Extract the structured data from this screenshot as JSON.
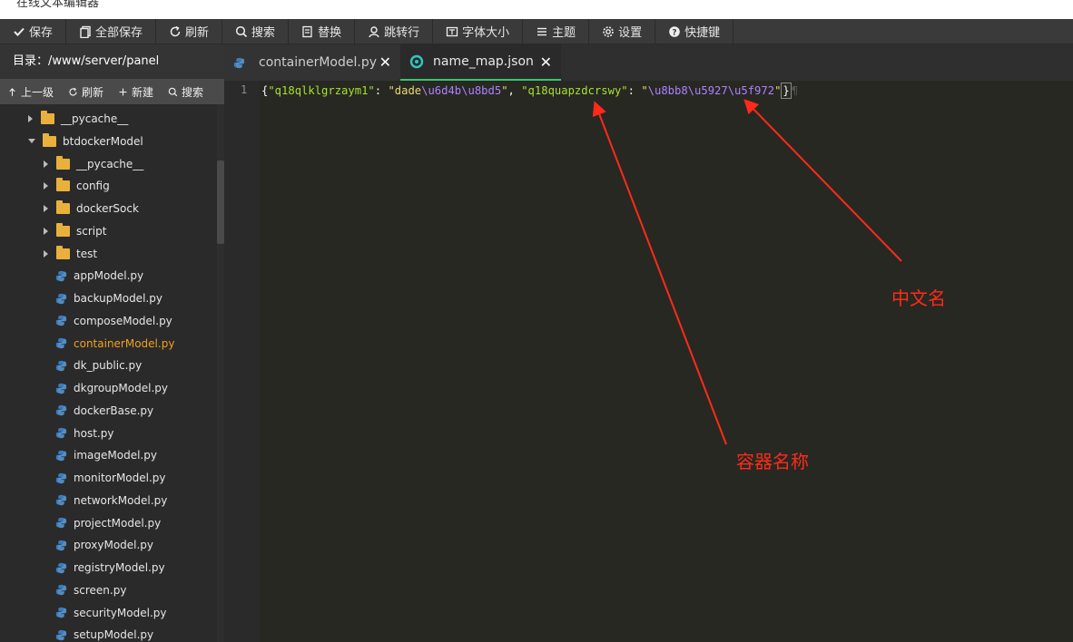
{
  "window": {
    "title": "在线文本编辑器"
  },
  "toolbar": {
    "items": [
      {
        "label": "保存",
        "icon": "check-icon"
      },
      {
        "label": "全部保存",
        "icon": "copy-icon"
      },
      {
        "label": "刷新",
        "icon": "refresh-icon"
      },
      {
        "label": "搜索",
        "icon": "search-icon"
      },
      {
        "label": "替换",
        "icon": "replace-icon"
      },
      {
        "label": "跳转行",
        "icon": "jump-icon"
      },
      {
        "label": "字体大小",
        "icon": "font-size-icon"
      },
      {
        "label": "主题",
        "icon": "theme-icon"
      },
      {
        "label": "设置",
        "icon": "gear-icon"
      },
      {
        "label": "快捷键",
        "icon": "help-icon"
      }
    ]
  },
  "sidebar": {
    "directory_label": "目录：/www/server/panel",
    "actions": [
      {
        "label": "上一级",
        "icon": "arrow-up-icon"
      },
      {
        "label": "刷新",
        "icon": "refresh-icon"
      },
      {
        "label": "新建",
        "icon": "plus-icon"
      },
      {
        "label": "搜索",
        "icon": "search-icon"
      }
    ],
    "tree": [
      {
        "label": "__pycache__",
        "type": "folder",
        "level": 1,
        "state": "collapsed"
      },
      {
        "label": "btdockerModel",
        "type": "folder",
        "level": 1,
        "state": "expanded"
      },
      {
        "label": "__pycache__",
        "type": "folder",
        "level": 2,
        "state": "collapsed"
      },
      {
        "label": "config",
        "type": "folder",
        "level": 2,
        "state": "collapsed"
      },
      {
        "label": "dockerSock",
        "type": "folder",
        "level": 2,
        "state": "collapsed"
      },
      {
        "label": "script",
        "type": "folder",
        "level": 2,
        "state": "collapsed"
      },
      {
        "label": "test",
        "type": "folder",
        "level": 2,
        "state": "collapsed"
      },
      {
        "label": "appModel.py",
        "type": "file",
        "level": 2
      },
      {
        "label": "backupModel.py",
        "type": "file",
        "level": 2
      },
      {
        "label": "composeModel.py",
        "type": "file",
        "level": 2
      },
      {
        "label": "containerModel.py",
        "type": "file",
        "level": 2,
        "active": true
      },
      {
        "label": "dk_public.py",
        "type": "file",
        "level": 2
      },
      {
        "label": "dkgroupModel.py",
        "type": "file",
        "level": 2
      },
      {
        "label": "dockerBase.py",
        "type": "file",
        "level": 2
      },
      {
        "label": "host.py",
        "type": "file",
        "level": 2
      },
      {
        "label": "imageModel.py",
        "type": "file",
        "level": 2
      },
      {
        "label": "monitorModel.py",
        "type": "file",
        "level": 2
      },
      {
        "label": "networkModel.py",
        "type": "file",
        "level": 2
      },
      {
        "label": "projectModel.py",
        "type": "file",
        "level": 2
      },
      {
        "label": "proxyModel.py",
        "type": "file",
        "level": 2
      },
      {
        "label": "registryModel.py",
        "type": "file",
        "level": 2
      },
      {
        "label": "screen.py",
        "type": "file",
        "level": 2
      },
      {
        "label": "securityModel.py",
        "type": "file",
        "level": 2
      },
      {
        "label": "setupModel.py",
        "type": "file",
        "level": 2
      }
    ]
  },
  "tabs": [
    {
      "label": "containerModel.py",
      "icon": "python-icon",
      "close": "✕"
    },
    {
      "label": "name_map.json",
      "icon": "json-icon",
      "close": "✕",
      "active": true
    }
  ],
  "editor": {
    "line_number": "1",
    "tokens": [
      {
        "t": "{",
        "c": "brace"
      },
      {
        "t": "\"q18qlklgrzaym1\"",
        "c": "key"
      },
      {
        "t": ": ",
        "c": "punc"
      },
      {
        "t": "\"dade",
        "c": "str"
      },
      {
        "t": "\\u6d4b\\u8bd5",
        "c": "esc"
      },
      {
        "t": "\"",
        "c": "str"
      },
      {
        "t": ", ",
        "c": "punc"
      },
      {
        "t": "\"q18quapzdcrswy\"",
        "c": "key"
      },
      {
        "t": ": ",
        "c": "punc"
      },
      {
        "t": "\"",
        "c": "str"
      },
      {
        "t": "\\u8bb8\\u5927\\u5f972",
        "c": "esc"
      },
      {
        "t": "\"",
        "c": "str"
      },
      {
        "t": "}",
        "c": "cursor"
      },
      {
        "t": "¶",
        "c": "pil"
      }
    ]
  },
  "annotations": {
    "chinese_name": "中文名",
    "container_name": "容器名称",
    "color": "#ff2a1a"
  },
  "colors": {
    "accent_tab": "#3cc46f",
    "active_file": "#f0a020",
    "folder": "#e9b13c"
  }
}
